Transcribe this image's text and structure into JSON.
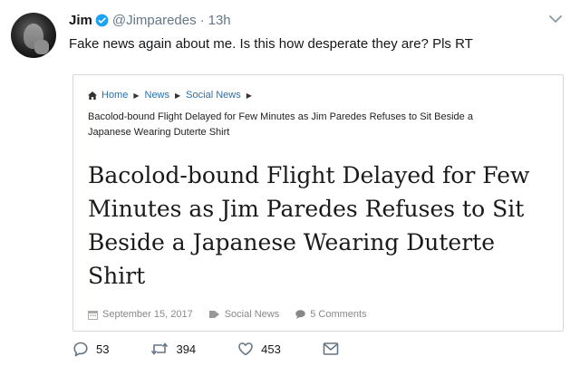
{
  "tweet": {
    "author_name": "Jim",
    "handle": "@Jimparedes",
    "separator": "·",
    "time": "13h",
    "text": "Fake news again about me. Is this how desperate they are? Pls RT"
  },
  "card": {
    "breadcrumb": [
      {
        "label": "Home",
        "icon": "home-icon"
      },
      {
        "label": "News"
      },
      {
        "label": "Social News"
      }
    ],
    "crumb_title": "Bacolod-bound Flight Delayed for Few Minutes as Jim Paredes Refuses to Sit Beside a Japanese Wearing Duterte Shirt",
    "headline": "Bacolod-bound Flight Delayed for Few Minutes as Jim Paredes Refuses to Sit Beside a Japanese Wearing Duterte Shirt",
    "meta": {
      "date": "September 15, 2017",
      "category": "Social News",
      "comments": "5 Comments"
    }
  },
  "actions": {
    "replies": "53",
    "retweets": "394",
    "likes": "453"
  },
  "colors": {
    "verified": "#1da1f2",
    "link": "#2b6fa9",
    "muted": "#657786"
  }
}
